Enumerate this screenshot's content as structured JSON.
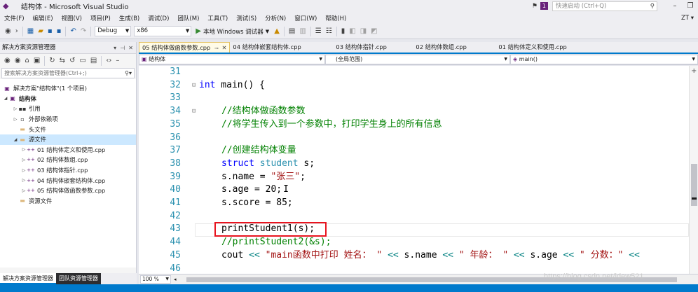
{
  "title": {
    "logo": "◆",
    "text": "结构体 - Microsoft Visual Studio",
    "notification_count": "1",
    "quick_launch_placeholder": "快速启动 (Ctrl+Q)"
  },
  "menu": {
    "items": [
      "文件(F)",
      "编辑(E)",
      "视图(V)",
      "项目(P)",
      "生成(B)",
      "调试(D)",
      "团队(M)",
      "工具(T)",
      "测试(S)",
      "分析(N)",
      "窗口(W)",
      "帮助(H)"
    ],
    "user_initials": "ZT ▾"
  },
  "toolbar": {
    "config": "Debug",
    "platform": "x86",
    "run_label": "本地 Windows 调试器"
  },
  "solution_explorer": {
    "header": "解决方案资源管理器",
    "search_placeholder": "搜索解决方案资源管理器(Ctrl+;)",
    "tree": {
      "solution": "解决方案\"结构体\"(1 个项目)",
      "project": "结构体",
      "references": "引用",
      "external_deps": "外部依赖项",
      "header_files": "头文件",
      "source_files": "源文件",
      "files": [
        "01 结构体定义和使用.cpp",
        "02 结构体数组.cpp",
        "03 结构体指针.cpp",
        "04 结构体嵌套结构体.cpp",
        "05 结构体做函数参数.cpp"
      ],
      "resource_files": "资源文件"
    },
    "tabs": [
      "解决方案资源管理器",
      "团队资源管理器"
    ]
  },
  "editor": {
    "tabs": [
      "05 结构体做函数参数.cpp",
      "04 结构体嵌套结构体.cpp",
      "03 结构体指针.cpp",
      "02 结构体数组.cpp",
      "01 结构体定义和使用.cpp"
    ],
    "nav": {
      "project": "结构体",
      "scope": "(全局范围)",
      "member": "main()"
    },
    "zoom": "100 %",
    "lines": [
      {
        "num": "31"
      },
      {
        "num": "32"
      },
      {
        "num": "33"
      },
      {
        "num": "34"
      },
      {
        "num": "35"
      },
      {
        "num": "36"
      },
      {
        "num": "37"
      },
      {
        "num": "38"
      },
      {
        "num": "39"
      },
      {
        "num": "40"
      },
      {
        "num": "41"
      },
      {
        "num": "42"
      },
      {
        "num": "43"
      },
      {
        "num": "44"
      },
      {
        "num": "45"
      },
      {
        "num": "46"
      }
    ],
    "code": {
      "l32_kw": "int",
      "l32_rest": " main() {",
      "l34": "//结构体做函数参数",
      "l35": "//将学生传入到一个参数中，打印学生身上的所有信息",
      "l37": "//创建结构体变量",
      "l38_kw": "struct",
      "l38_ty": "student",
      "l38_rest": " s;",
      "l39_a": "s.name = ",
      "l39_str": "\"张三\"",
      "l39_b": ";",
      "l40": "s.age = 20;",
      "l41": "s.score = 85;",
      "l43": "printStudent1(s);",
      "l44": "//printStudent2(&s);",
      "l45_a": "cout ",
      "l45_op1": "<<",
      "l45_str1": " \"main函数中打印 姓名： \"",
      "l45_op2": " <<",
      "l45_b": " s.name ",
      "l45_op3": "<<",
      "l45_str2": " \" 年龄： \"",
      "l45_op4": " <<",
      "l45_c": " s.age ",
      "l45_op5": "<<",
      "l45_str3": " \" 分数：\"",
      "l45_op6": " <<"
    }
  },
  "watermark": "https://blog.csdn.net/ldew521"
}
